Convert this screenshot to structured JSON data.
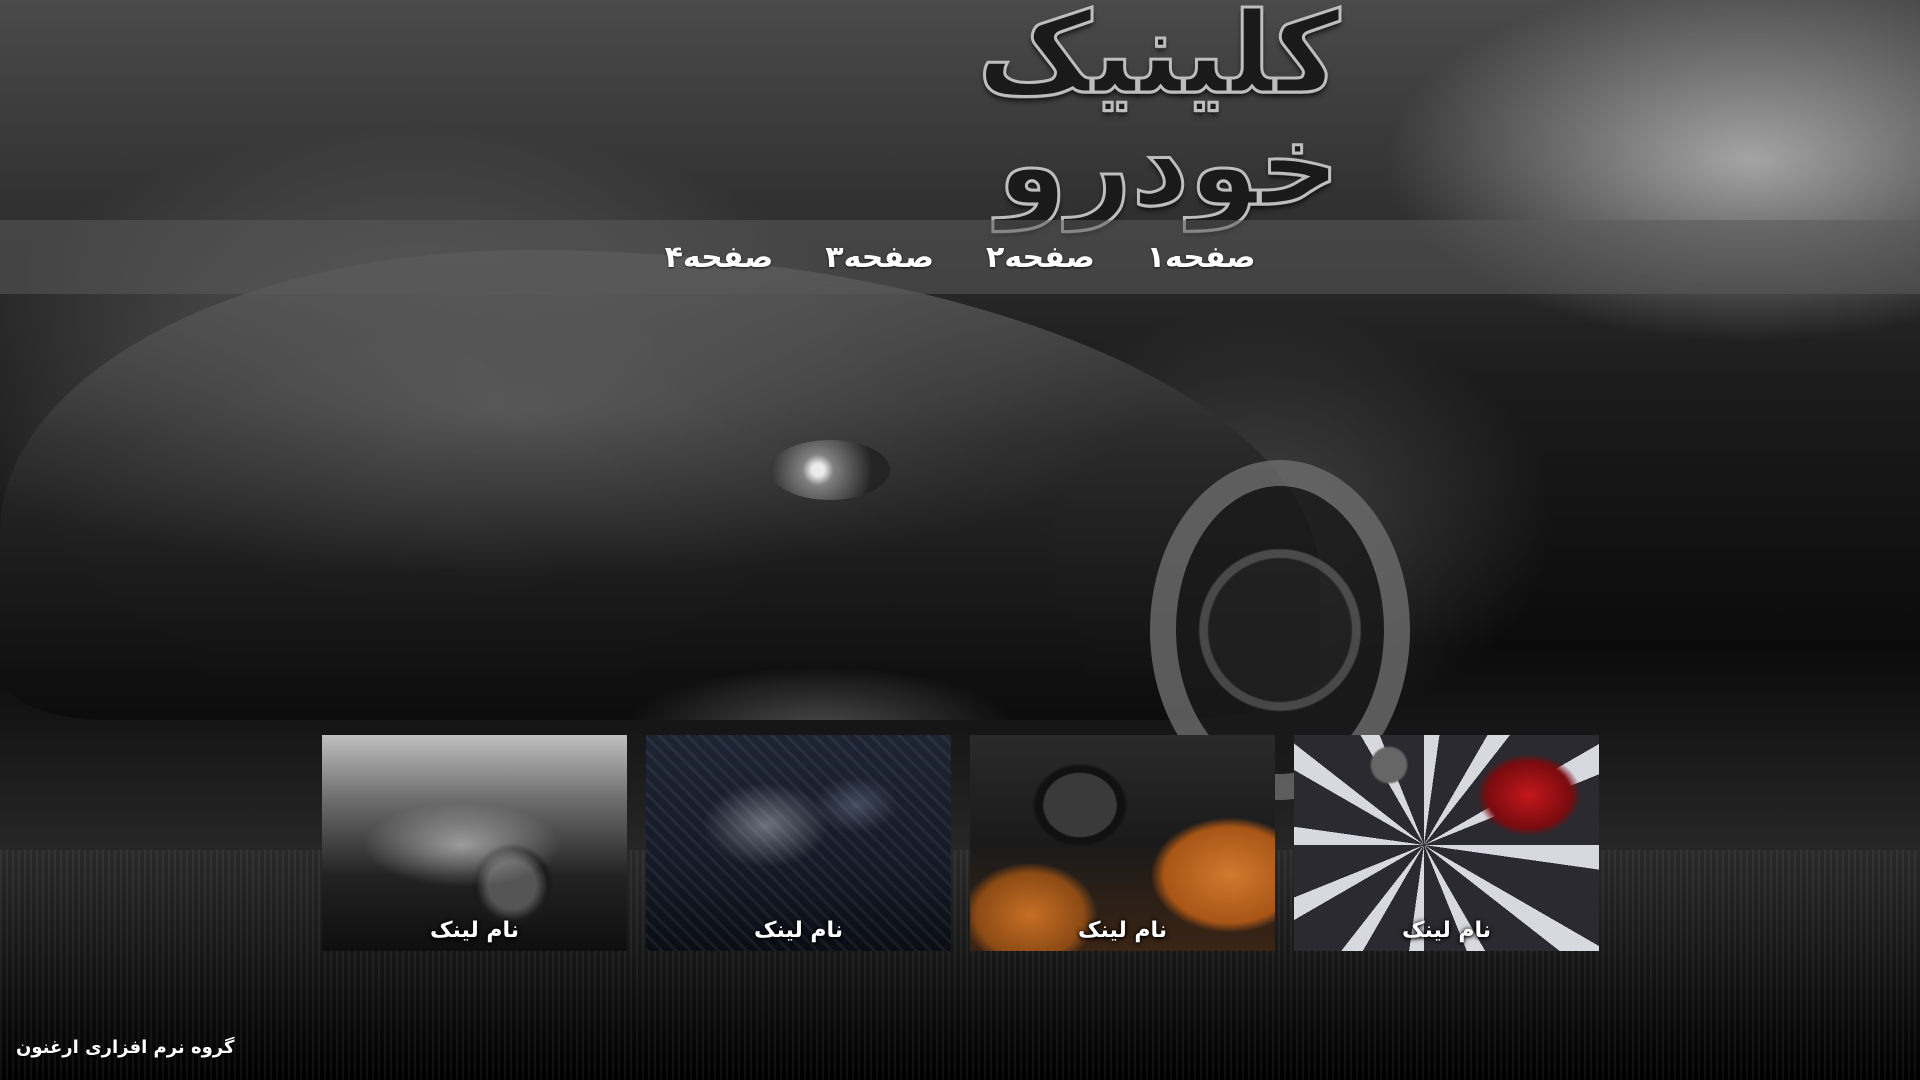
{
  "site": {
    "title": "کلینیک خودرو",
    "footer_credit": "گروه نرم افزاری ارغنون"
  },
  "nav": {
    "items": [
      {
        "label": "صفحه۱"
      },
      {
        "label": "صفحه۲"
      },
      {
        "label": "صفحه۳"
      },
      {
        "label": "صفحه۴"
      }
    ]
  },
  "cards": [
    {
      "label": "نام لینک",
      "image": "sports-car-photo"
    },
    {
      "label": "نام لینک",
      "image": "engine-bay-photo"
    },
    {
      "label": "نام لینک",
      "image": "car-interior-photo"
    },
    {
      "label": "نام لینک",
      "image": "alloy-wheel-photo"
    }
  ],
  "colors": {
    "nav_bar": "#5a5a5a",
    "text": "#ffffff",
    "background": "#000000"
  }
}
